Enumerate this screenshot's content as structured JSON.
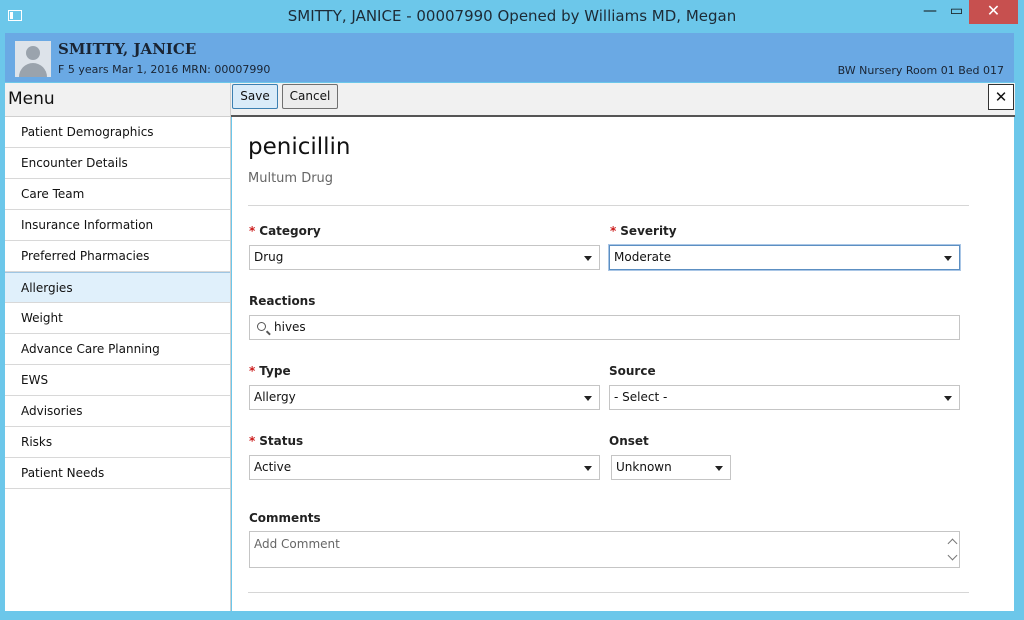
{
  "window": {
    "title": "SMITTY, JANICE - 00007990 Opened by Williams MD, Megan",
    "minimize_glyph": "—",
    "maximize_glyph": "▭",
    "close_glyph": "✕"
  },
  "patient": {
    "name": "SMITTY, JANICE",
    "info": "F 5 years Mar 1, 2016 MRN: 00007990",
    "location": "BW Nursery Room 01 Bed 017"
  },
  "menu": {
    "title": "Menu",
    "items": [
      {
        "label": "Patient Demographics"
      },
      {
        "label": "Encounter Details"
      },
      {
        "label": "Care Team"
      },
      {
        "label": "Insurance Information"
      },
      {
        "label": "Preferred Pharmacies"
      },
      {
        "label": "Allergies",
        "active": true
      },
      {
        "label": "Weight"
      },
      {
        "label": "Advance Care Planning"
      },
      {
        "label": "EWS"
      },
      {
        "label": "Advisories"
      },
      {
        "label": "Risks"
      },
      {
        "label": "Patient Needs"
      }
    ]
  },
  "toolbar": {
    "save_label": "Save",
    "cancel_label": "Cancel",
    "close_glyph": "✕"
  },
  "allergy": {
    "name": "penicillin",
    "subtitle": "Multum Drug",
    "required_mark": "*",
    "category": {
      "label": "Category",
      "value": "Drug"
    },
    "severity": {
      "label": "Severity",
      "value": "Moderate"
    },
    "reactions": {
      "label": "Reactions",
      "value": "hives"
    },
    "type": {
      "label": "Type",
      "value": "Allergy"
    },
    "source": {
      "label": "Source",
      "value": "- Select -"
    },
    "status": {
      "label": "Status",
      "value": "Active"
    },
    "onset": {
      "label": "Onset",
      "value": "Unknown"
    },
    "comments": {
      "label": "Comments",
      "placeholder": "Add Comment"
    }
  },
  "colors": {
    "titlebar": "#6cc7ea",
    "banner": "#6aa9e4",
    "close_button": "#c7504f",
    "active_menu": "#e0f0fb",
    "required": "#cc1c1c"
  }
}
